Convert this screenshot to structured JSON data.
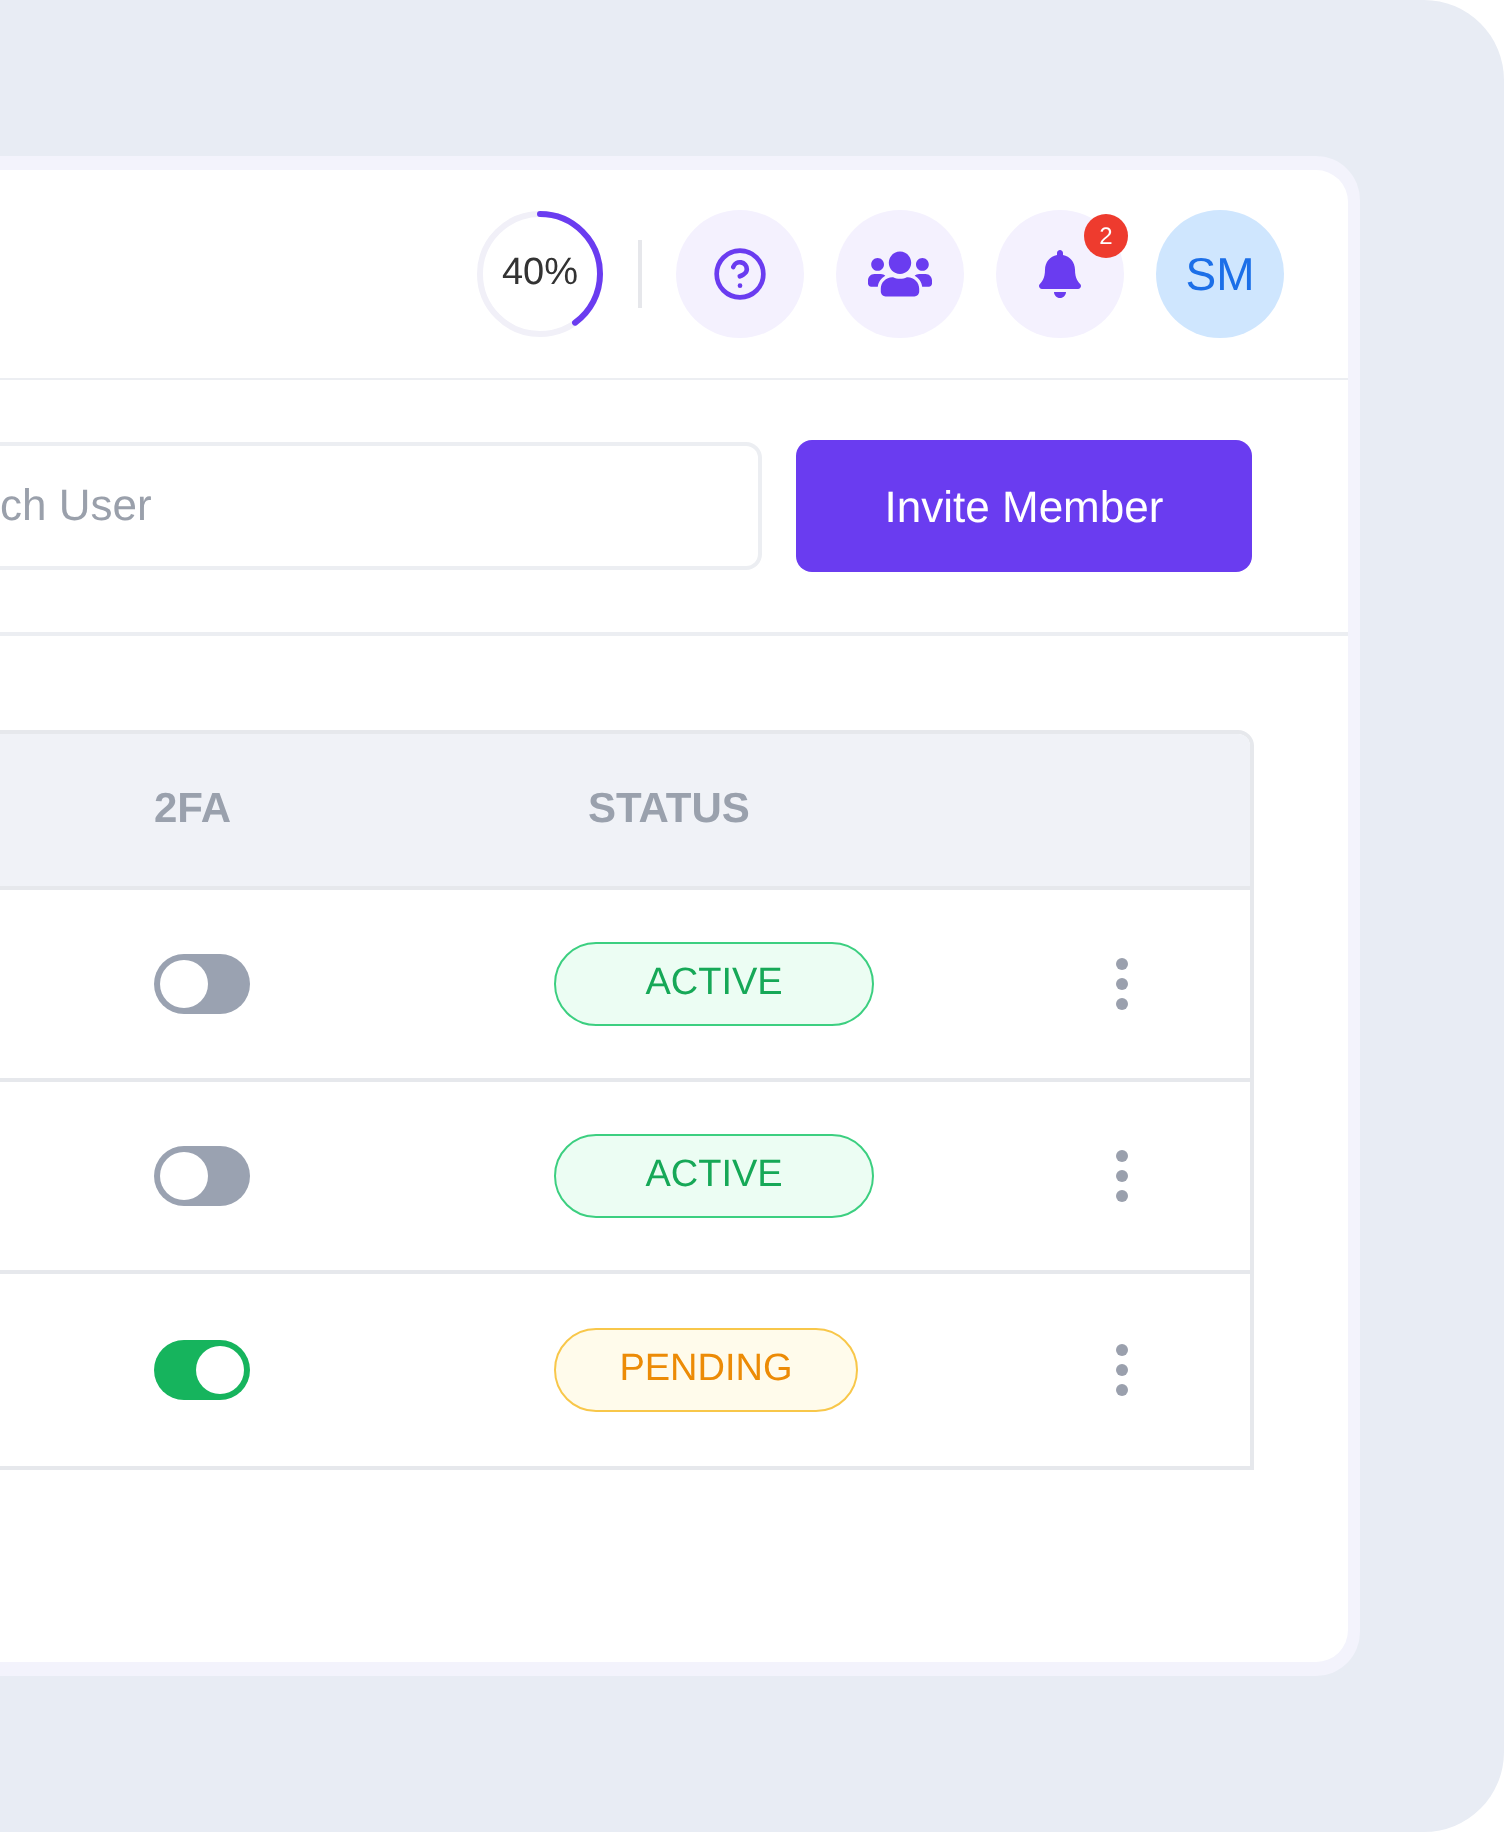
{
  "header": {
    "progress": {
      "label": "40%",
      "level": 0.4
    },
    "notifications": {
      "badge": "2"
    },
    "avatar": {
      "initials": "SM"
    }
  },
  "search": {
    "placeholder": "ch User"
  },
  "invite_button": "Invite Member",
  "table": {
    "columns": [
      "2FA",
      "STATUS"
    ],
    "rows": [
      {
        "two_fa_on": false,
        "status": {
          "label": "ACTIVE",
          "kind": "active"
        }
      },
      {
        "two_fa_on": false,
        "status": {
          "label": "ACTIVE",
          "kind": "active"
        }
      },
      {
        "two_fa_on": true,
        "status": {
          "label": "PENDING",
          "kind": "pending"
        }
      }
    ]
  }
}
